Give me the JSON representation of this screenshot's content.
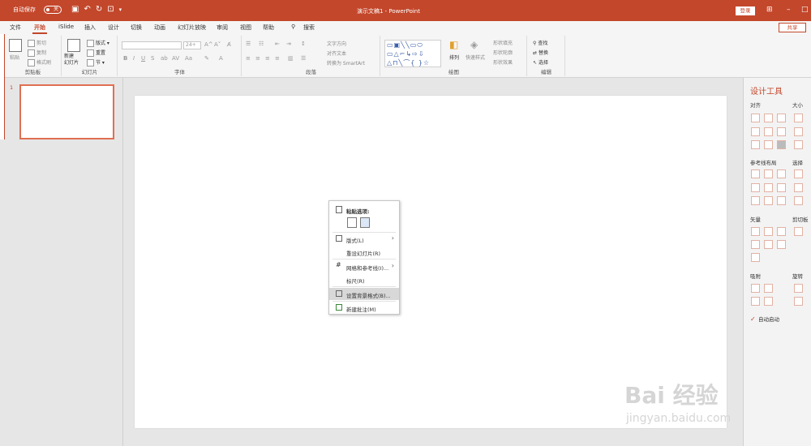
{
  "titlebar": {
    "autosave": "自动保存",
    "toggle": "关",
    "title": "演示文稿1 - PowerPoint",
    "signin": "登录"
  },
  "menu": {
    "tabs": [
      "文件",
      "开始",
      "iSlide",
      "插入",
      "设计",
      "切换",
      "动画",
      "幻灯片放映",
      "审阅",
      "视图",
      "帮助"
    ],
    "search": "搜索",
    "share": "共享"
  },
  "ribbon": {
    "clipboard": {
      "label": "剪贴板",
      "paste": "粘贴",
      "cut": "剪切",
      "copy": "复制",
      "format_painter": "格式刷"
    },
    "slides": {
      "label": "幻灯片",
      "new_slide": "新建\n幻灯片",
      "layout": "版式",
      "reset": "重置",
      "section": "节"
    },
    "font": {
      "label": "字体",
      "size": "24+"
    },
    "paragraph": {
      "label": "段落",
      "text_direction": "文字方向",
      "align_text": "对齐文本",
      "smartart": "转换为 SmartArt"
    },
    "drawing": {
      "label": "绘图",
      "arrange": "排列",
      "quick_styles": "快速样式",
      "fill": "形状填充",
      "outline": "形状轮廓",
      "effects": "形状效果"
    },
    "editing": {
      "label": "编辑",
      "find": "查找",
      "replace": "替换",
      "select": "选择"
    }
  },
  "thumbnails": {
    "slide_number": "1"
  },
  "context_menu": {
    "paste_options": "粘贴选项:",
    "items": [
      {
        "label": "版式(L)",
        "submenu": true
      },
      {
        "label": "重设幻灯片(R)",
        "submenu": false
      },
      {
        "label": "网格和参考线(I)...",
        "submenu": true
      },
      {
        "label": "标尺(R)",
        "submenu": false
      },
      {
        "label": "设置背景格式(B)...",
        "submenu": false,
        "highlighted": true
      },
      {
        "label": "新建批注(M)",
        "submenu": false
      }
    ]
  },
  "design_pane": {
    "title": "设计工具",
    "sections": [
      "对齐",
      "大小",
      "参考线布局",
      "选择",
      "矢量",
      "剪切板",
      "吸附",
      "旋转"
    ],
    "auto_enable": "自动启动"
  },
  "watermark": {
    "line1": "Bai 经验",
    "line2": "jingyan.baidu.com"
  },
  "colors": {
    "accent": "#c3472b"
  }
}
